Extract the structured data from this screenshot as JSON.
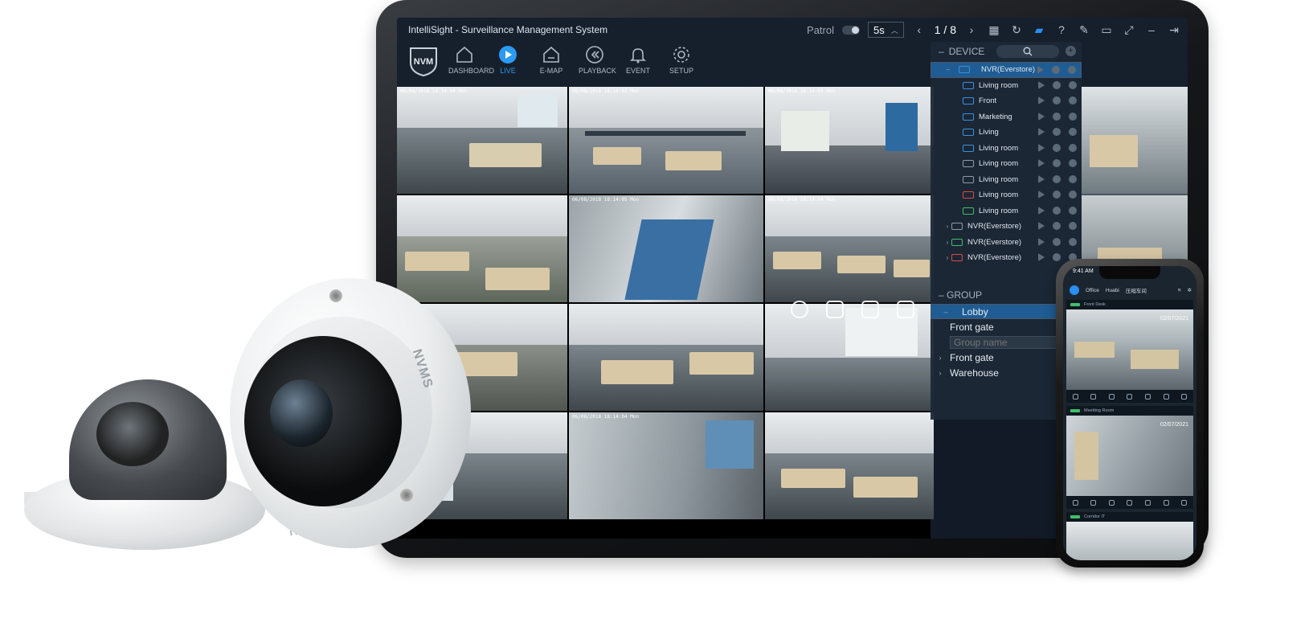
{
  "app": {
    "title": "IntelliSight - Surveillance Management System",
    "logo_text": "NVM"
  },
  "titlebar": {
    "patrol_label": "Patrol",
    "interval_value": "5s",
    "page_indicator": "1 / 8"
  },
  "nav": [
    {
      "label": "DASHBOARD",
      "icon": "home-icon"
    },
    {
      "label": "LIVE",
      "icon": "play-circle-icon",
      "active": true
    },
    {
      "label": "E-MAP",
      "icon": "map-home-icon"
    },
    {
      "label": "PLAYBACK",
      "icon": "rewind-icon"
    },
    {
      "label": "EVENT",
      "icon": "bell-icon"
    },
    {
      "label": "SETUP",
      "icon": "gear-icon"
    }
  ],
  "device_panel": {
    "header": "DEVICE",
    "items": [
      {
        "label": "NVR(Everstore)",
        "type": "nvr",
        "expanded": true,
        "selected": true
      },
      {
        "label": "Living room",
        "type": "cam",
        "color": "blue"
      },
      {
        "label": "Front",
        "type": "cam",
        "color": "blue"
      },
      {
        "label": "Marketing",
        "type": "cam",
        "color": "blue"
      },
      {
        "label": "Living",
        "type": "cam",
        "color": "blue"
      },
      {
        "label": "Living room",
        "type": "cam",
        "color": "blue"
      },
      {
        "label": "Living room",
        "type": "cam",
        "color": "gray"
      },
      {
        "label": "Living room",
        "type": "cam",
        "color": "gray"
      },
      {
        "label": "Living room",
        "type": "cam",
        "color": "red"
      },
      {
        "label": "Living room",
        "type": "cam",
        "color": "green"
      },
      {
        "label": "NVR(Everstore)",
        "type": "nvr",
        "color": "gray"
      },
      {
        "label": "NVR(Everstore)",
        "type": "nvr",
        "color": "green"
      },
      {
        "label": "NVR(Everstore)",
        "type": "nvr",
        "color": "red"
      }
    ]
  },
  "group_panel": {
    "header": "GROUP",
    "items": [
      {
        "label": "Lobby",
        "expanded": true,
        "selected": true
      },
      {
        "label": "Front gate"
      },
      {
        "label": "Front gate",
        "collapsed": true
      },
      {
        "label": "Warehouse",
        "collapsed": true
      }
    ],
    "new_group_placeholder": "Group name"
  },
  "feeds": [
    {
      "timestamp": "06/08/2018 18:14:04  Mon"
    },
    {
      "timestamp": "06/08/2018 18:14:01  Mon"
    },
    {
      "timestamp": "06/08/2018 18:14:03  Mon"
    },
    {
      "timestamp": ""
    },
    {
      "timestamp": "06/08/2018 18:14:05  Mon"
    },
    {
      "timestamp": "06/08/2018 18:14:04  Mon"
    },
    {
      "timestamp": ""
    },
    {
      "timestamp": ""
    },
    {
      "timestamp": ""
    },
    {
      "timestamp": ""
    },
    {
      "timestamp": "06/08/2018 18:14:04  Mon"
    },
    {
      "timestamp": ""
    }
  ],
  "phone": {
    "time": "9:41 AM",
    "tabs": [
      "Office",
      "Huabi",
      "压缩车间"
    ],
    "cards": [
      {
        "name": "Front Desk",
        "date": "02/07/2021"
      },
      {
        "name": "Meetting Room",
        "date": "02/07/2021"
      },
      {
        "name": "Corridor IT",
        "date": ""
      }
    ]
  },
  "hardware": {
    "fisheye_brand": "NVMS",
    "base_brand": "NVMS"
  },
  "colors": {
    "accent": "#2b9af3",
    "panel_bg": "#16202c",
    "selection": "#1f5c93"
  }
}
